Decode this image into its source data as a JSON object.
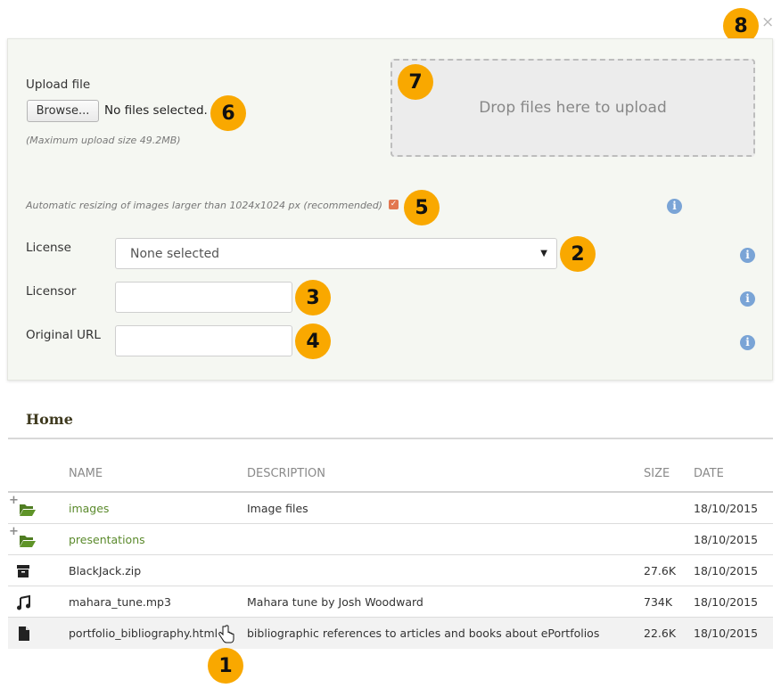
{
  "dialog": {
    "close_label": "×"
  },
  "upload": {
    "label": "Upload file",
    "browse_button": "Browse...",
    "no_files": "No files selected.",
    "max_size": "(Maximum upload size 49.2MB)",
    "dropzone_text": "Drop files here to upload"
  },
  "resize": {
    "label": "Automatic resizing of images larger than 1024x1024 px (recommended)",
    "checked": true
  },
  "form": {
    "license_label": "License",
    "license_value": "None selected",
    "licensor_label": "Licensor",
    "licensor_value": "",
    "original_url_label": "Original URL",
    "original_url_value": ""
  },
  "callouts": [
    "1",
    "2",
    "3",
    "4",
    "5",
    "6",
    "7",
    "8"
  ],
  "folder": {
    "title": "Home",
    "columns": [
      "NAME",
      "DESCRIPTION",
      "SIZE",
      "DATE"
    ],
    "rows": [
      {
        "icon": "folder-open-icon",
        "expandable": true,
        "name": "images",
        "description": "Image files",
        "size": "",
        "date": "18/10/2015",
        "is_folder": true
      },
      {
        "icon": "folder-open-icon",
        "expandable": true,
        "name": "presentations",
        "description": "",
        "size": "",
        "date": "18/10/2015",
        "is_folder": true
      },
      {
        "icon": "archive-icon",
        "expandable": false,
        "name": "BlackJack.zip",
        "description": "",
        "size": "27.6K",
        "date": "18/10/2015",
        "is_folder": false
      },
      {
        "icon": "music-icon",
        "expandable": false,
        "name": "mahara_tune.mp3",
        "description": "Mahara tune by Josh Woodward",
        "size": "734K",
        "date": "18/10/2015",
        "is_folder": false
      },
      {
        "icon": "file-icon",
        "expandable": false,
        "name": "portfolio_bibliography.html",
        "description": "bibliographic references to articles and books about ePortfolios",
        "size": "22.6K",
        "date": "18/10/2015",
        "is_folder": false
      }
    ]
  },
  "colors": {
    "badge": "#f9a800",
    "panel_bg": "#f5f7f2",
    "folder_link": "#5b8a2c",
    "info_icon": "#7aa4d6",
    "checkbox": "#e2774f"
  }
}
